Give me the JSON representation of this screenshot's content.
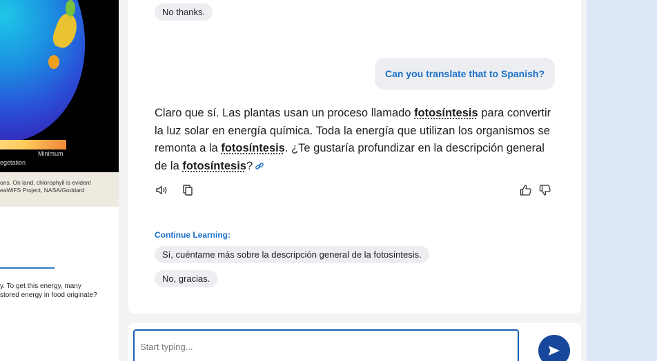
{
  "left_panel": {
    "legend_minimum": "Minimum",
    "legend_vegetation": "egetation",
    "caption": "ons. On land, chlorophyll is evident\neaWiFS Project, NASA/Goddard",
    "body": "y. To get this energy, many\nstored energy in food originate?"
  },
  "chat": {
    "previous_chip": "No thanks.",
    "user_message": "Can you translate that to Spanish?",
    "response": {
      "part1": "Claro que sí. Las plantas usan un proceso llamado ",
      "kw1": "fotosíntesis",
      "part2": " para convertir la luz solar en energía química. Toda la energía que utilizan los organismos se remonta a la ",
      "kw2": "fotosíntesis",
      "part3": ". ¿Te gustaría profundizar en la descripción general de la ",
      "kw3": "fotosíntesis",
      "part4": "?"
    },
    "continue_label": "Continue Learning:",
    "suggestions": [
      "Sí, cuéntame más sobre la descripción general de la fotosíntesis.",
      "No, gracias."
    ]
  },
  "input": {
    "placeholder": "Start typing...",
    "value": ""
  },
  "icons": {
    "speaker": "speaker-icon",
    "copy": "copy-icon",
    "thumbs_up": "thumbs-up-icon",
    "thumbs_down": "thumbs-down-icon",
    "link": "link-icon",
    "send": "send-icon"
  },
  "colors": {
    "accent": "#1a6fc7",
    "send_button": "#16479a",
    "input_border": "#1a5fb4",
    "side_panel": "#dbe6f6"
  }
}
